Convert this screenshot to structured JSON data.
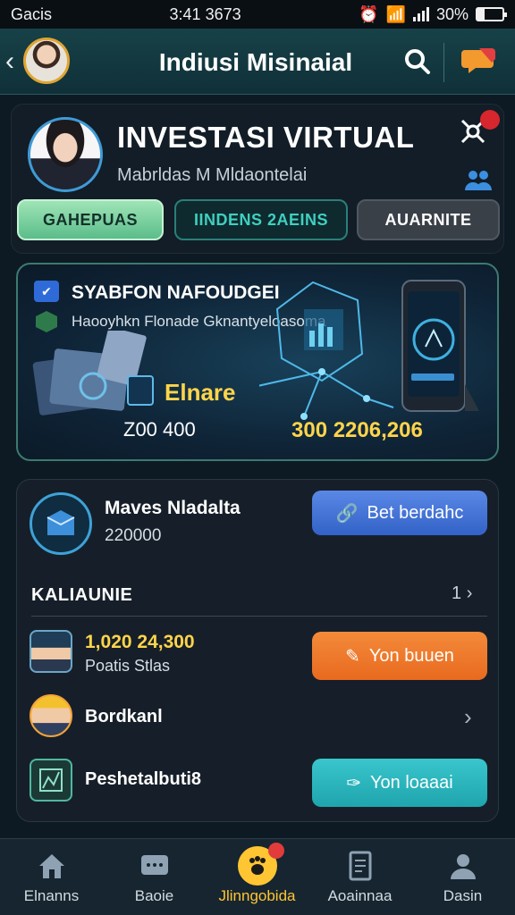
{
  "status": {
    "carrier": "Gacis",
    "time": "3:41 3673",
    "battery": "30%",
    "battery_level": 0.3
  },
  "header": {
    "title": "Indiusi Misinaial",
    "icons": [
      "back-icon",
      "avatar",
      "search-icon",
      "chat-icon"
    ]
  },
  "profile": {
    "title": "INVESTASI VIRTUAL",
    "subtitle": "Mabrldas M Mldaontelai",
    "tabs": [
      "GAHEPUAS",
      "IINDENS 2AEINS",
      "AUARNITE"
    ],
    "notification_count": ""
  },
  "hero": {
    "title": "SYABFON NAFOUDGEI",
    "subtitle": "Haooyhkn Flonade Gknantyeloasoma",
    "badge_label": "Elnare",
    "left_value": "Z00 400",
    "right_value": "300 2206,206"
  },
  "wallet": {
    "label": "Maves Nladalta",
    "value": "220000",
    "button": "Bet berdahc"
  },
  "section": {
    "title": "KALIAUNIE",
    "more": "1"
  },
  "rows": [
    {
      "value": "1,020 24,300",
      "label": "Poatis Stlas",
      "button": "Yon buuen"
    },
    {
      "label": "Bordkanl"
    },
    {
      "label": "Peshetalbuti8",
      "button": "Yon loaaai"
    }
  ],
  "nav": {
    "items": [
      "Elnanns",
      "Baoie",
      "Jlinngobida",
      "Aoainnaa",
      "Dasin"
    ],
    "active_index": 2
  },
  "colors": {
    "accent_gold": "#ffd54a",
    "header_bg": "#174148",
    "button_blue": "#4a76d8",
    "button_orange": "#f07a2c",
    "button_teal": "#2cb6bd"
  }
}
